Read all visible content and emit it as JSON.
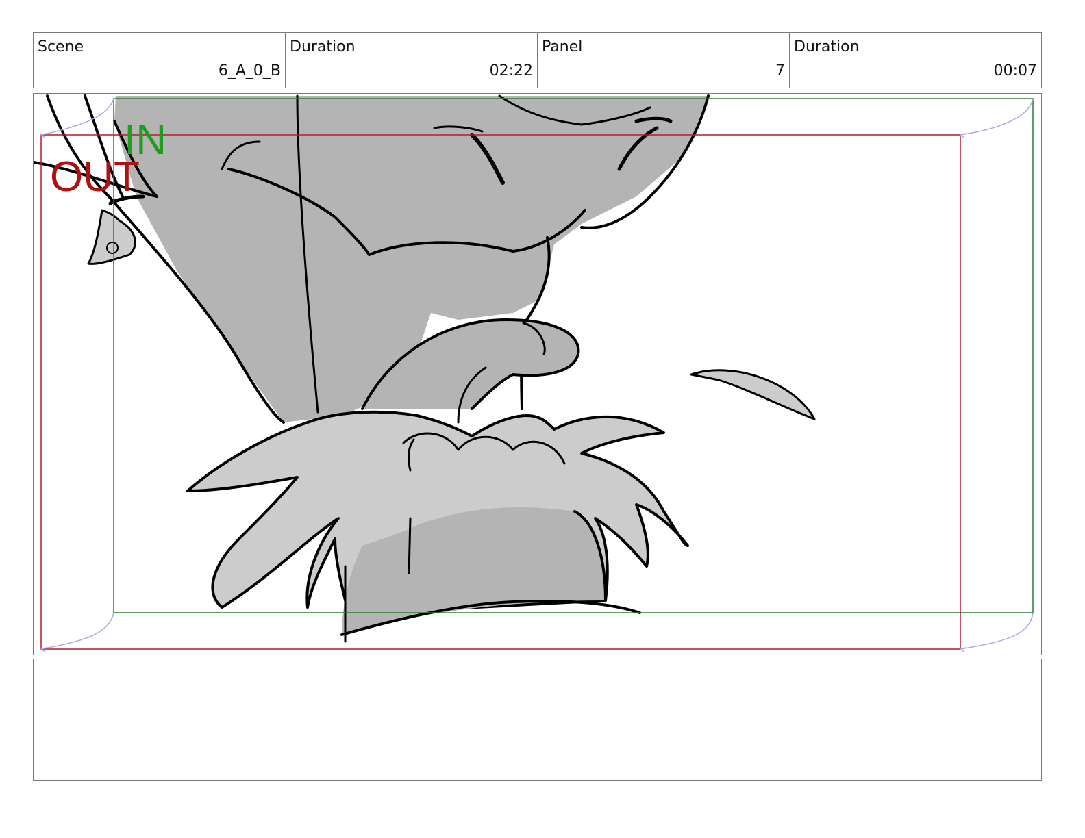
{
  "header": {
    "scene_label": "Scene",
    "scene_value": "6_A_0_B",
    "scene_duration_label": "Duration",
    "scene_duration_value": "02:22",
    "panel_label": "Panel",
    "panel_value": "7",
    "panel_duration_label": "Duration",
    "panel_duration_value": "00:07"
  },
  "panel": {
    "in_label": "IN",
    "out_label": "OUT",
    "in_color": "#1e9e1e",
    "out_color": "#b01010",
    "in_frame_color": "#2e7d32",
    "out_frame_color": "#b01e2a",
    "motion_arrow_color": "#a8a8e6",
    "sketch_fill_dark": "#b4b4b4",
    "sketch_fill_light": "#cccccc"
  },
  "notes": {
    "text": ""
  }
}
